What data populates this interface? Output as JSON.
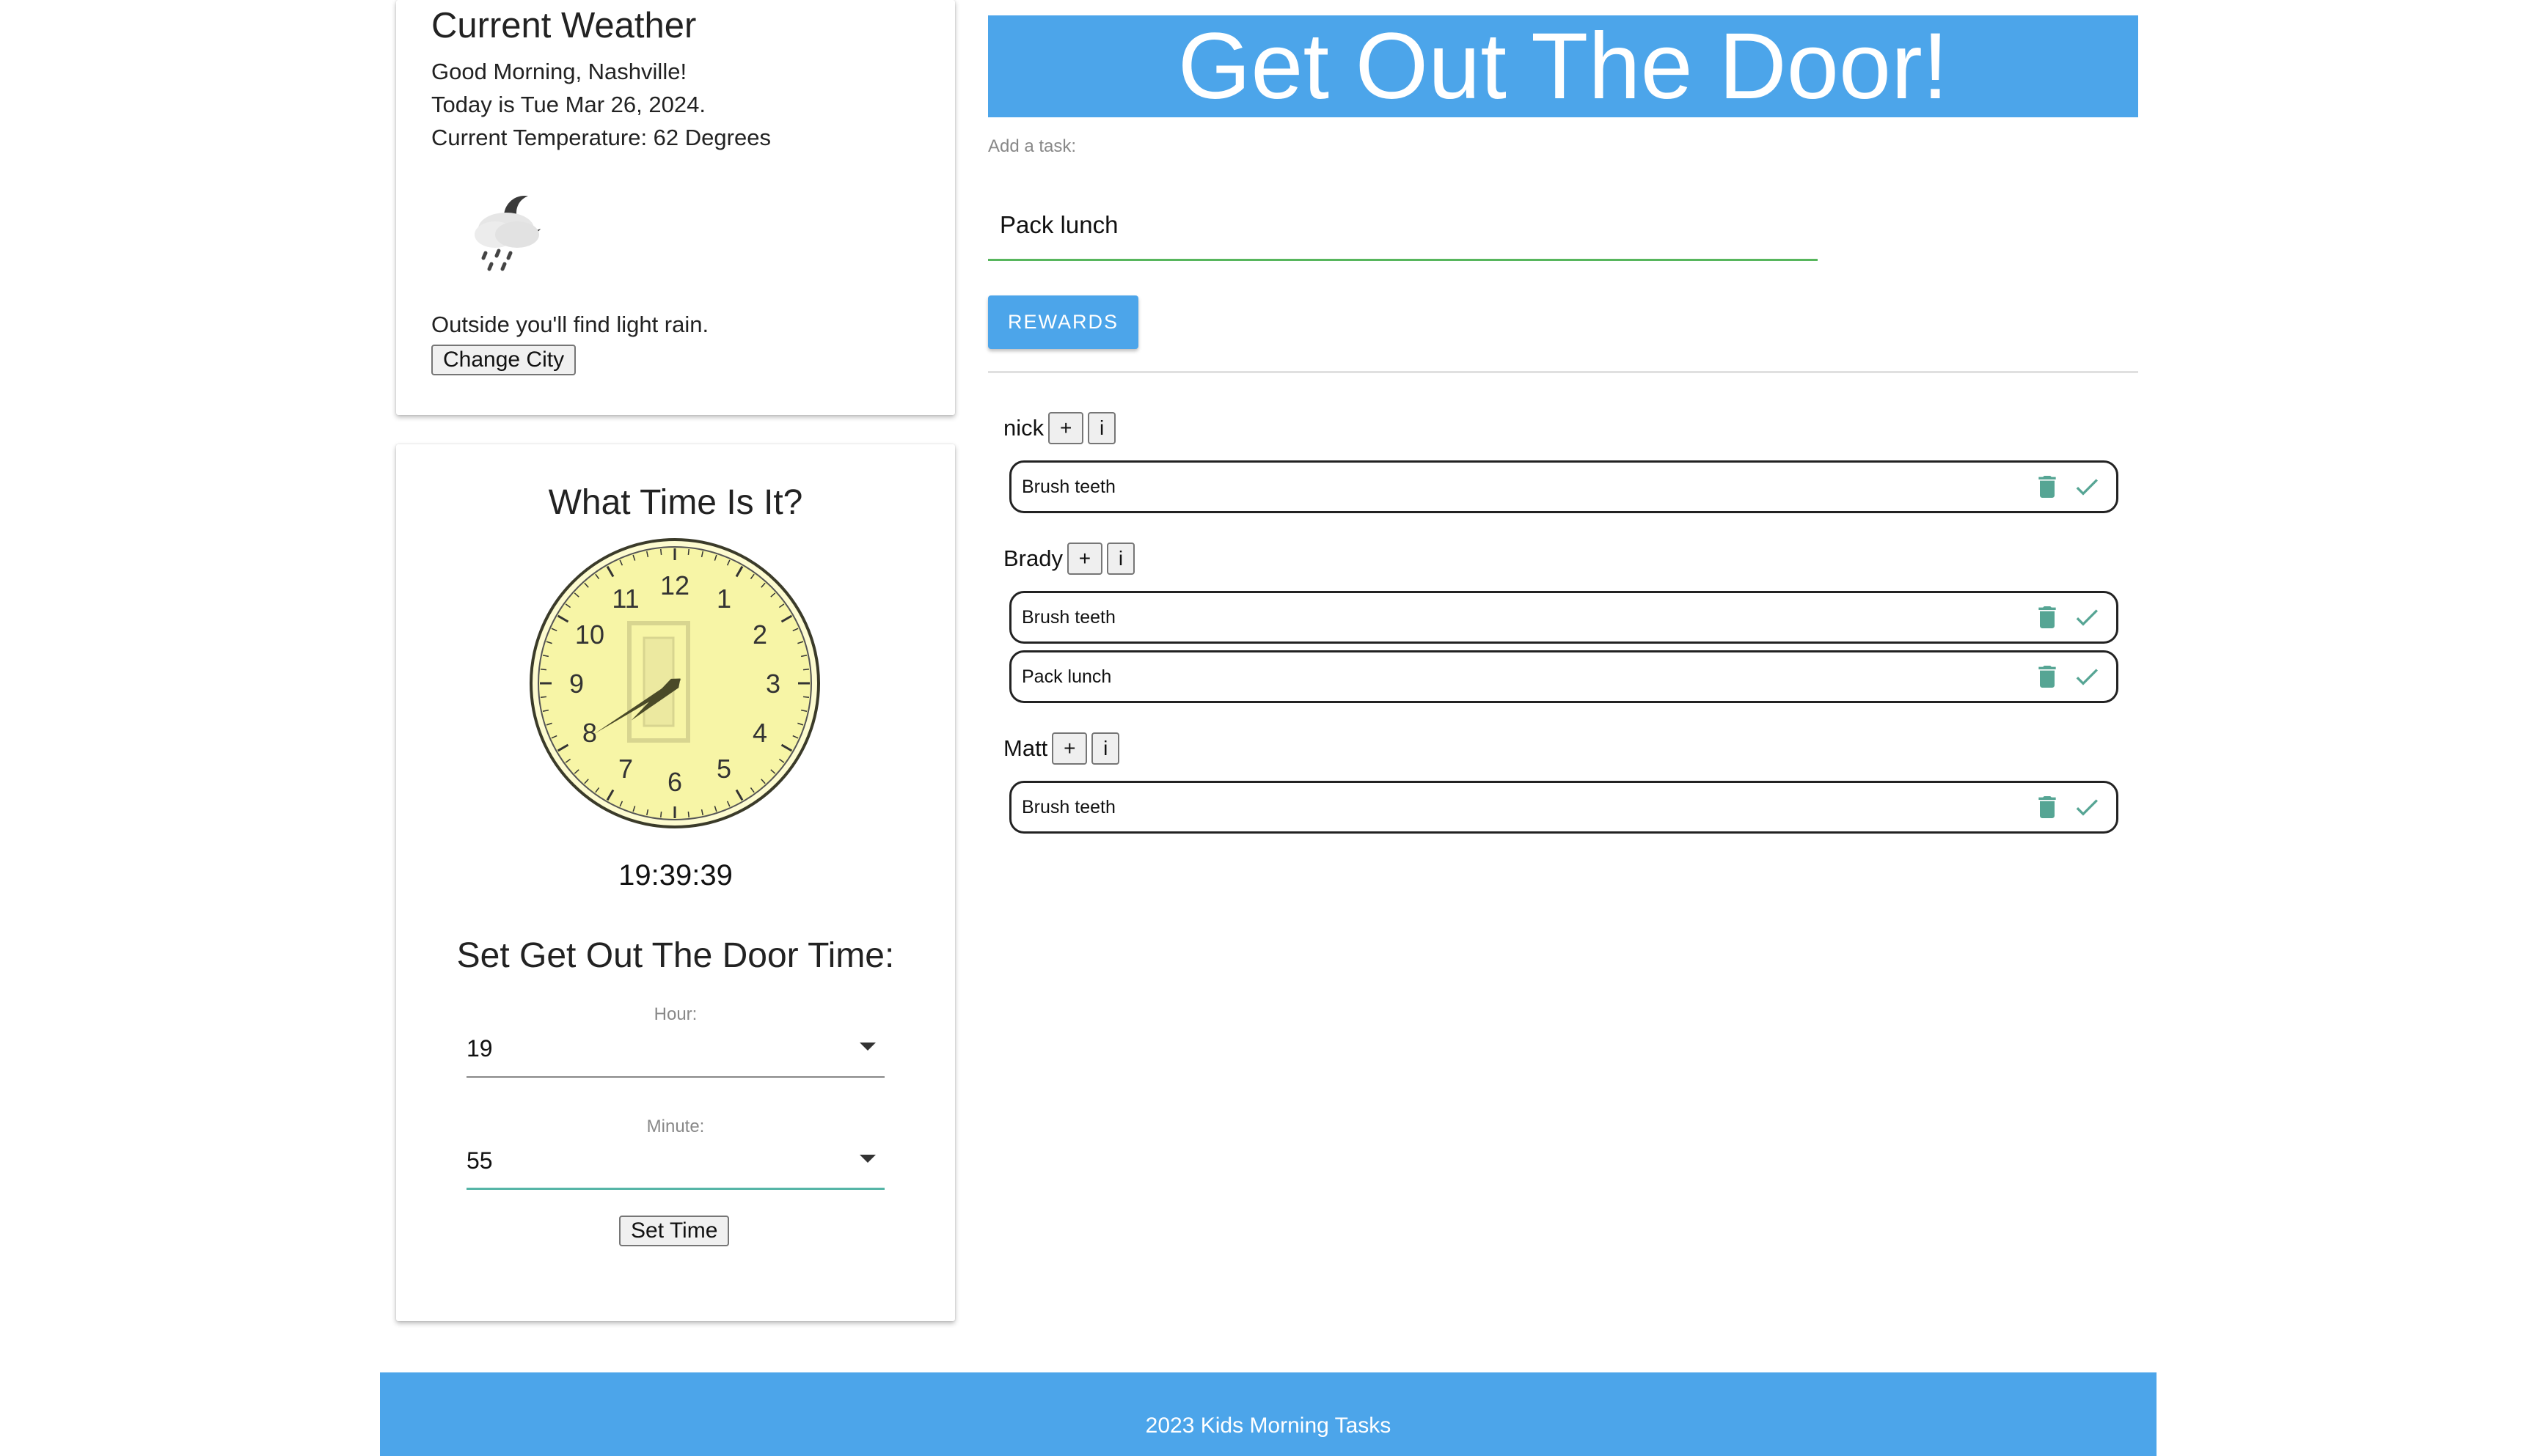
{
  "weather": {
    "title": "Current Weather",
    "greeting": "Good Morning, Nashville!",
    "date_line": "Today is Tue Mar 26, 2024.",
    "temp_line": "Current Temperature: 62 Degrees",
    "icon": "cloud-moon-rain-icon",
    "outside_line": "Outside you'll find light rain.",
    "change_city_label": "Change City"
  },
  "clock": {
    "heading": "What Time Is It?",
    "numbers": [
      "12",
      "1",
      "2",
      "3",
      "4",
      "5",
      "6",
      "7",
      "8",
      "9",
      "10",
      "11"
    ],
    "hour": 19,
    "minute": 39,
    "second": 39,
    "face_color": "#f7f5a6",
    "digital_time": "19:39:39"
  },
  "door_time": {
    "heading": "Set Get Out The Door Time:",
    "hour_label": "Hour:",
    "hour_value": "19",
    "minute_label": "Minute:",
    "minute_value": "55",
    "set_time_label": "Set Time"
  },
  "main": {
    "title": "Get Out The Door!",
    "add_task_label": "Add a task:",
    "task_input_value": "Pack lunch",
    "rewards_label": "REWARDS"
  },
  "kids": [
    {
      "name": "nick",
      "add_label": "+",
      "info_label": "i",
      "tasks": [
        "Brush teeth"
      ]
    },
    {
      "name": "Brady",
      "add_label": "+",
      "info_label": "i",
      "tasks": [
        "Brush teeth",
        "Pack lunch"
      ]
    },
    {
      "name": "Matt",
      "add_label": "+",
      "info_label": "i",
      "tasks": [
        "Brush teeth"
      ]
    }
  ],
  "footer": {
    "text": "2023 Kids Morning Tasks"
  },
  "colors": {
    "accent": "#4ca5ea",
    "input_underline": "#57b65d",
    "task_icon": "#56a594"
  }
}
